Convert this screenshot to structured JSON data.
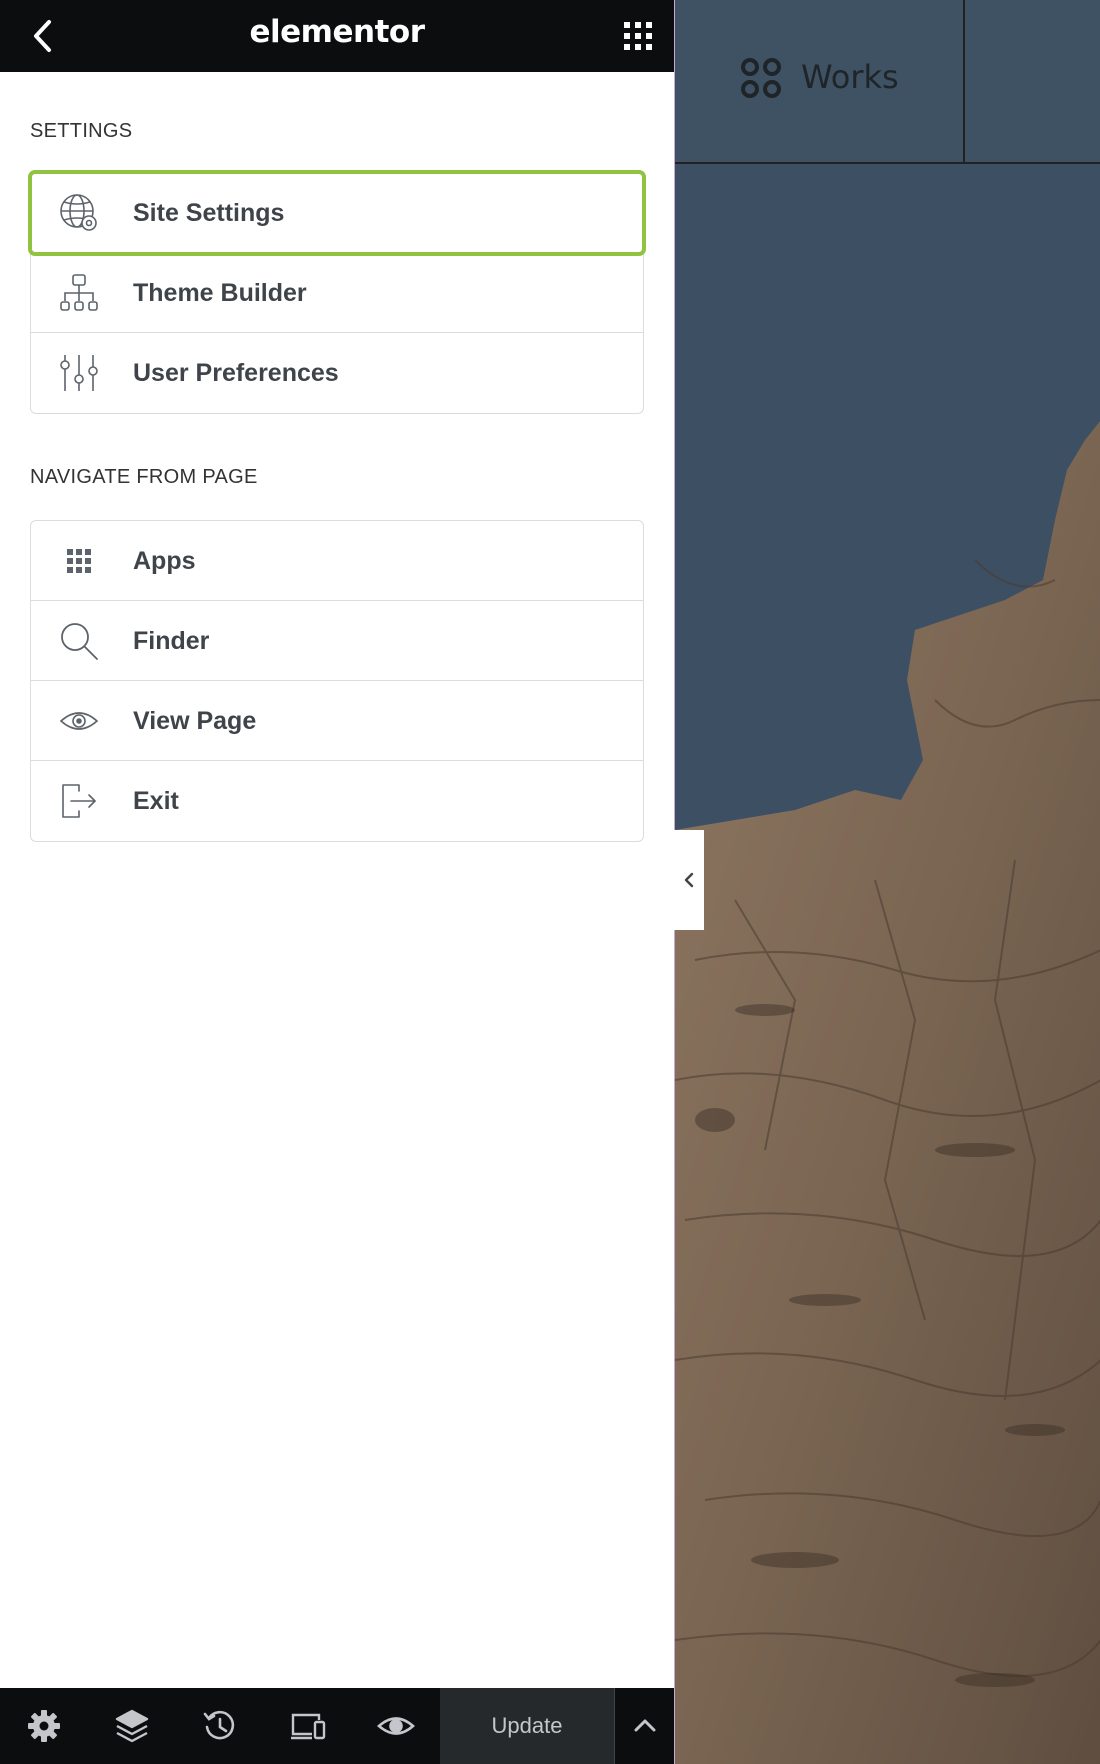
{
  "header": {
    "brand": "elementor",
    "back_icon": "chevron-left-icon",
    "apps_icon": "grid-icon"
  },
  "settings": {
    "title": "SETTINGS",
    "items": [
      {
        "label": "Site Settings",
        "icon": "globe-gear-icon",
        "highlighted": true
      },
      {
        "label": "Theme Builder",
        "icon": "sitemap-icon"
      },
      {
        "label": "User Preferences",
        "icon": "sliders-icon"
      }
    ]
  },
  "navigate": {
    "title": "NAVIGATE FROM PAGE",
    "items": [
      {
        "label": "Apps",
        "icon": "grid-icon"
      },
      {
        "label": "Finder",
        "icon": "search-icon"
      },
      {
        "label": "View Page",
        "icon": "eye-icon"
      },
      {
        "label": "Exit",
        "icon": "exit-icon"
      }
    ]
  },
  "footer": {
    "icons": [
      "settings-icon",
      "layers-icon",
      "history-icon",
      "responsive-icon",
      "preview-eye-icon"
    ],
    "update_label": "Update"
  },
  "preview": {
    "nav_label": "Works",
    "nav_icon": "four-circles-icon"
  },
  "colors": {
    "highlight": "#92c340",
    "header_bg": "#0c0d0e",
    "sky": "#3d5063"
  }
}
